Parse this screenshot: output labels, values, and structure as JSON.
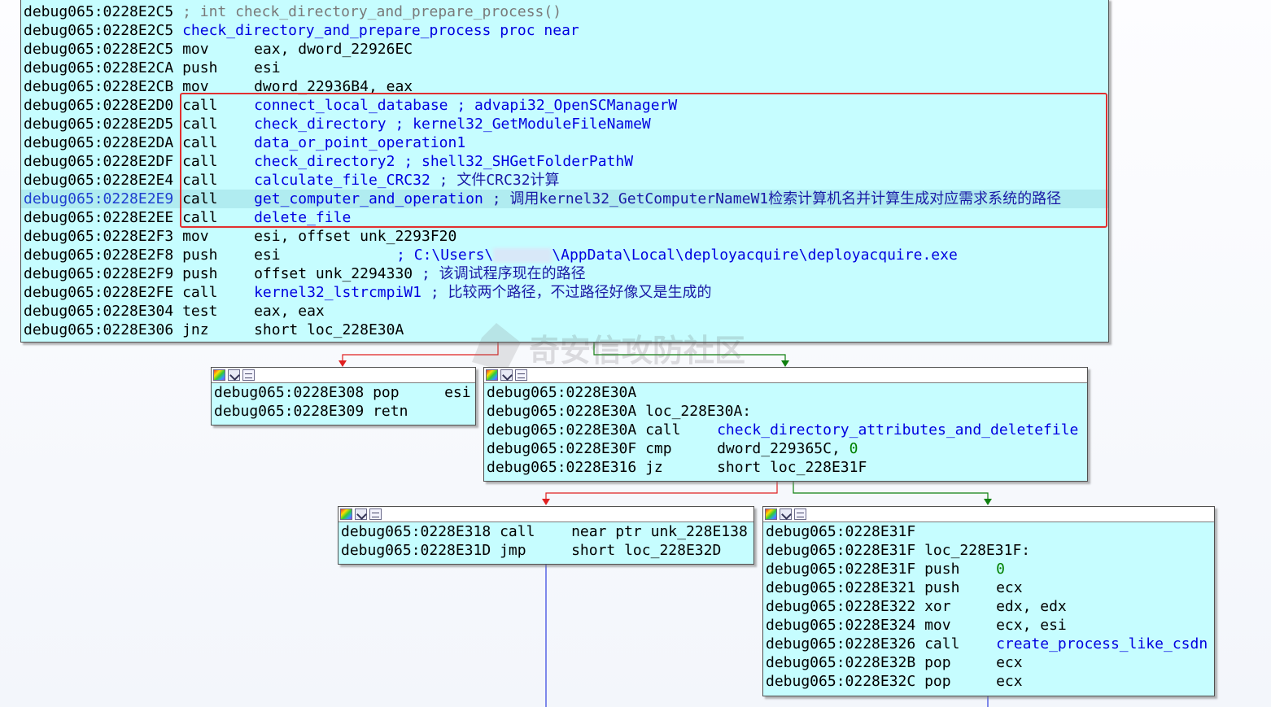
{
  "watermark": {
    "text": "奇安信攻防社区"
  },
  "edge_colors": {
    "true_branch": "#e02020",
    "false_branch": "#108010",
    "unconditional": "#3040e0"
  },
  "main_block": {
    "lines": [
      {
        "addr": "debug065:0228E2C5",
        "mn": "",
        "ops": "",
        "comment": "; int check_directory_and_prepare_process()"
      },
      {
        "addr": "debug065:0228E2C5",
        "mn": "",
        "ops": "check_directory_and_prepare_process proc near",
        "comment": ""
      },
      {
        "addr": "debug065:0228E2C5",
        "mn": "mov",
        "ops": "eax, dword_22926EC",
        "comment": ""
      },
      {
        "addr": "debug065:0228E2CA",
        "mn": "push",
        "ops": "esi",
        "comment": ""
      },
      {
        "addr": "debug065:0228E2CB",
        "mn": "mov",
        "ops": "dword_22936B4, eax",
        "comment": ""
      },
      {
        "addr": "debug065:0228E2D0",
        "mn": "call",
        "ops": "connect_local_database",
        "comment": "; advapi32_OpenSCManagerW"
      },
      {
        "addr": "debug065:0228E2D5",
        "mn": "call",
        "ops": "check_directory",
        "comment": "; kernel32_GetModuleFileNameW"
      },
      {
        "addr": "debug065:0228E2DA",
        "mn": "call",
        "ops": "data_or_point_operation1",
        "comment": ""
      },
      {
        "addr": "debug065:0228E2DF",
        "mn": "call",
        "ops": "check_directory2",
        "comment": "; shell32_SHGetFolderPathW"
      },
      {
        "addr": "debug065:0228E2E4",
        "mn": "call",
        "ops": "calculate_file_CRC32",
        "comment": "; 文件CRC32计算"
      },
      {
        "addr": "debug065:0228E2E9",
        "mn": "call",
        "ops": "get_computer_and_operation",
        "comment": "; 调用kernel32_GetComputerNameW1检索计算机名并计算生成对应需求系统的路径"
      },
      {
        "addr": "debug065:0228E2EE",
        "mn": "call",
        "ops": "delete_file",
        "comment": ""
      },
      {
        "addr": "debug065:0228E2F3",
        "mn": "mov",
        "ops": "esi, offset unk_2293F20",
        "comment": ""
      },
      {
        "addr": "debug065:0228E2F8",
        "mn": "push",
        "ops": "esi",
        "comment": "; C:\\Users\\"
      },
      {
        "addr": "debug065:0228E2F9",
        "mn": "push",
        "ops": "offset unk_2294330",
        "comment": "; 该调试程序现在的路径"
      },
      {
        "addr": "debug065:0228E2FE",
        "mn": "call",
        "ops": "kernel32_lstrcmpiW1",
        "comment": "; 比较两个路径，不过路径好像又是生成的"
      },
      {
        "addr": "debug065:0228E304",
        "mn": "test",
        "ops": "eax, eax",
        "comment": ""
      },
      {
        "addr": "debug065:0228E306",
        "mn": "jnz",
        "ops": "short loc_228E30A",
        "comment": ""
      }
    ],
    "path_suffix": "\\AppData\\Local\\deployacquire\\deployacquire.exe"
  },
  "block_pop": {
    "lines": [
      {
        "addr": "debug065:0228E308",
        "mn": "pop",
        "ops": "esi"
      },
      {
        "addr": "debug065:0228E309",
        "mn": "retn",
        "ops": ""
      }
    ]
  },
  "block_30a": {
    "lines": [
      {
        "addr": "debug065:0228E30A",
        "mn": "",
        "ops": ""
      },
      {
        "addr": "debug065:0228E30A",
        "mn": "",
        "ops": "loc_228E30A:"
      },
      {
        "addr": "debug065:0228E30A",
        "mn": "call",
        "ops": "check_directory_attributes_and_deletefile"
      },
      {
        "addr": "debug065:0228E30F",
        "mn": "cmp",
        "ops": "dword_229365C,",
        "num": "0"
      },
      {
        "addr": "debug065:0228E316",
        "mn": "jz",
        "ops": "short loc_228E31F"
      }
    ]
  },
  "block_318": {
    "lines": [
      {
        "addr": "debug065:0228E318",
        "mn": "call",
        "ops": "near ptr unk_228E138"
      },
      {
        "addr": "debug065:0228E31D",
        "mn": "jmp",
        "ops": "short loc_228E32D"
      }
    ]
  },
  "block_31f": {
    "lines": [
      {
        "addr": "debug065:0228E31F",
        "mn": "",
        "ops": ""
      },
      {
        "addr": "debug065:0228E31F",
        "mn": "",
        "ops": "loc_228E31F:"
      },
      {
        "addr": "debug065:0228E31F",
        "mn": "push",
        "ops": "",
        "num": "0"
      },
      {
        "addr": "debug065:0228E321",
        "mn": "push",
        "ops": "ecx"
      },
      {
        "addr": "debug065:0228E322",
        "mn": "xor",
        "ops": "edx, edx"
      },
      {
        "addr": "debug065:0228E324",
        "mn": "mov",
        "ops": "ecx, esi"
      },
      {
        "addr": "debug065:0228E326",
        "mn": "call",
        "ops": "create_process_like_csdn"
      },
      {
        "addr": "debug065:0228E32B",
        "mn": "pop",
        "ops": "ecx"
      },
      {
        "addr": "debug065:0228E32C",
        "mn": "pop",
        "ops": "ecx"
      }
    ]
  }
}
